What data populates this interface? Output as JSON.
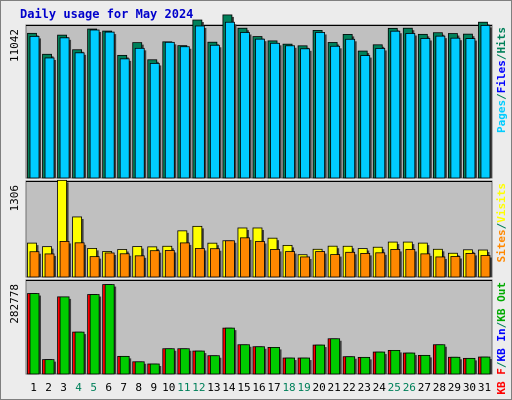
{
  "chart_data": [
    {
      "type": "bar",
      "panel": "hits",
      "title": "Daily usage for May 2024",
      "categories": [
        "1",
        "2",
        "3",
        "4",
        "5",
        "6",
        "7",
        "8",
        "9",
        "10",
        "11",
        "12",
        "13",
        "14",
        "15",
        "16",
        "17",
        "18",
        "19",
        "20",
        "21",
        "22",
        "23",
        "24",
        "25",
        "26",
        "27",
        "28",
        "29",
        "30",
        "31"
      ],
      "weekend_days": [
        "4",
        "5",
        "11",
        "12",
        "18",
        "19",
        "25",
        "26"
      ],
      "ylim": [
        0,
        11042
      ],
      "y_tick_label": "11042",
      "legend": [
        "Pages",
        "Files",
        "Hits"
      ],
      "series": [
        {
          "name": "Hits",
          "color": "#00805a",
          "values": [
            10440,
            8928,
            10310,
            9256,
            10749,
            10603,
            8850,
            9770,
            8532,
            9828,
            9552,
            11400,
            9800,
            11769,
            10809,
            10208,
            9895,
            9658,
            9540,
            10651,
            9780,
            10362,
            9160,
            9613,
            10800,
            10810,
            10367,
            10485,
            10426,
            10382,
            11243
          ]
        },
        {
          "name": "Files",
          "color": "#00ccff",
          "values": [
            10218,
            8664,
            10116,
            9034,
            10680,
            10529,
            8598,
            9358,
            8268,
            9790,
            9473,
            10971,
            9578,
            11241,
            10500,
            10019,
            9720,
            9542,
            9325,
            10504,
            9505,
            10010,
            8835,
            9350,
            10593,
            10429,
            10069,
            10237,
            10090,
            10061,
            11008
          ]
        },
        {
          "name": "Pages",
          "color": "#00ccff",
          "values": [
            10218,
            8664,
            10116,
            9034,
            10680,
            10529,
            8598,
            9358,
            8268,
            9790,
            9473,
            10971,
            9578,
            11241,
            10500,
            10019,
            9720,
            9542,
            9325,
            10504,
            9505,
            10010,
            8835,
            9350,
            10593,
            10429,
            10069,
            10237,
            10090,
            10061,
            11008
          ]
        }
      ],
      "colors": {
        "pages": "#00ccff",
        "files": "#00ccff",
        "hits": "#00805a"
      }
    },
    {
      "type": "bar",
      "panel": "visits",
      "categories": [
        "1",
        "2",
        "3",
        "4",
        "5",
        "6",
        "7",
        "8",
        "9",
        "10",
        "11",
        "12",
        "13",
        "14",
        "15",
        "16",
        "17",
        "18",
        "19",
        "20",
        "21",
        "22",
        "23",
        "24",
        "25",
        "26",
        "27",
        "28",
        "29",
        "30",
        "31"
      ],
      "ylim": [
        0,
        1306
      ],
      "y_tick_label": "1306",
      "legend": [
        "Sites",
        "Visits"
      ],
      "series": [
        {
          "name": "Visits",
          "color": "#ffff00",
          "values": [
            461,
            413,
            1315,
            817,
            389,
            347,
            374,
            414,
            410,
            418,
            628,
            689,
            460,
            493,
            667,
            667,
            528,
            430,
            303,
            377,
            419,
            418,
            387,
            405,
            475,
            475,
            461,
            377,
            323,
            370,
            367
          ]
        },
        {
          "name": "Sites",
          "color": "#ff8800",
          "values": [
            344,
            314,
            484,
            465,
            277,
            327,
            316,
            288,
            358,
            361,
            464,
            388,
            385,
            493,
            533,
            483,
            375,
            346,
            273,
            346,
            305,
            336,
            321,
            329,
            375,
            375,
            315,
            273,
            279,
            321,
            292
          ]
        }
      ],
      "colors": {
        "visits": "#ffff00",
        "sites": "#ff8800"
      }
    },
    {
      "type": "bar",
      "panel": "traffic",
      "categories": [
        "1",
        "2",
        "3",
        "4",
        "5",
        "6",
        "7",
        "8",
        "9",
        "10",
        "11",
        "12",
        "13",
        "14",
        "15",
        "16",
        "17",
        "18",
        "19",
        "20",
        "21",
        "22",
        "23",
        "24",
        "25",
        "26",
        "27",
        "28",
        "29",
        "30",
        "31"
      ],
      "ylim": [
        0,
        282778
      ],
      "y_tick_label": "282778",
      "legend": [
        "KB F",
        "KB In",
        "KB Out"
      ],
      "series": [
        {
          "name": "KB F",
          "color": "#ff0000",
          "values": [
            242000,
            43240,
            232000,
            126000,
            239000,
            269000,
            53000,
            36700,
            30100,
            76000,
            76000,
            69000,
            55000,
            138000,
            88000,
            82000,
            80000,
            48000,
            48000,
            87000,
            106000,
            52000,
            50000,
            66000,
            71000,
            63000,
            56000,
            88000,
            50300,
            47000,
            51000
          ]
        },
        {
          "name": "KB Out",
          "color": "#00cc00",
          "values": [
            242000,
            43240,
            232000,
            126000,
            239000,
            269000,
            53000,
            36700,
            30100,
            76000,
            76000,
            69000,
            55000,
            138000,
            88000,
            82000,
            80000,
            48000,
            48000,
            87000,
            106000,
            52000,
            50000,
            66000,
            71000,
            63000,
            56000,
            88000,
            50300,
            47000,
            51000
          ]
        }
      ],
      "colors": {
        "kb_f": "#ff0000",
        "kb_in": "#0000ff",
        "kb_out": "#00cc00"
      }
    }
  ],
  "legend_colors": {
    "Hits": "#00805a",
    "Files": "#0000ff",
    "Pages": "#00ccff",
    "Visits": "#ffff00",
    "Sites": "#ff8800",
    "KB In": "#0000ff",
    "KB Out": "#00aa00",
    "KB F": "#ff0000",
    "separator": "#00805a"
  }
}
